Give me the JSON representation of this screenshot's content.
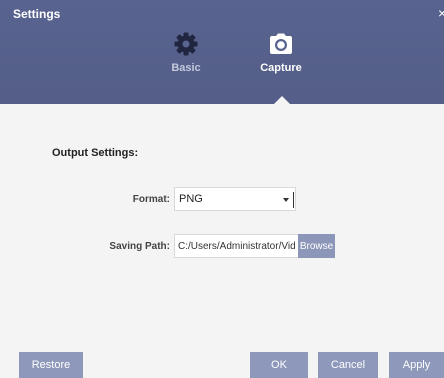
{
  "window": {
    "title": "Settings",
    "close_glyph": "×"
  },
  "tabs": [
    {
      "label": "Basic",
      "icon": "gear-icon",
      "active": false
    },
    {
      "label": "Capture",
      "icon": "camera-icon",
      "active": true
    }
  ],
  "output_settings": {
    "section_title": "Output Settings:",
    "format_label": "Format:",
    "format_value": "PNG",
    "saving_path_label": "Saving Path:",
    "saving_path_value": "C:/Users/Administrator/Videos/",
    "browse_label": "Browse"
  },
  "footer": {
    "restore_label": "Restore",
    "ok_label": "OK",
    "cancel_label": "Cancel",
    "apply_label": "Apply"
  },
  "colors": {
    "header_bg": "#58638f",
    "button_bg": "#8e98ba",
    "content_bg": "#f4f4f4"
  }
}
